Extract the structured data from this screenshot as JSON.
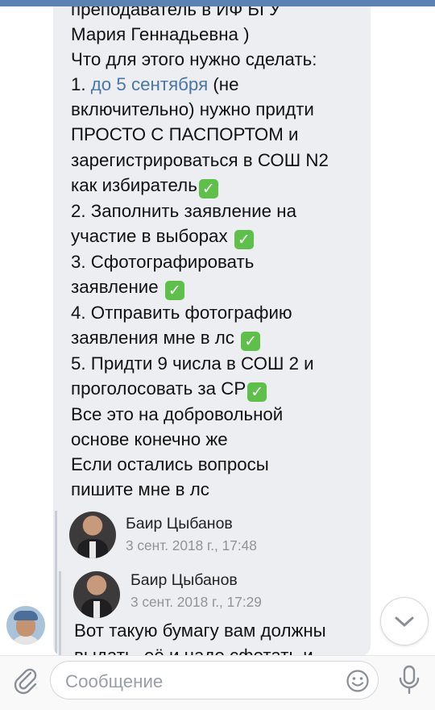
{
  "message": {
    "lines": [
      "преподаватель в ИФ БГУ",
      "Мария Геннадьевна )",
      "Что для этого нужно сделать:",
      "1. ",
      "до 5 сентября",
      " (не",
      "включительно) нужно придти",
      "ПРОСТО С ПАСПОРТОМ и",
      "зарегистрироваться в СОШ N2",
      "как избиратель",
      "2. Заполнить заявление на",
      "участие в выборах ",
      "3. Сфотографировать",
      "заявление ",
      "4. Отправить фотографию",
      "заявления мне в лс ",
      "5. Придти 9 числа в СОШ 2 и",
      "проголосовать за СР",
      "Все это на добровольной",
      "основе конечно же",
      "Если остались вопросы",
      "пишите мне в лс"
    ],
    "check_mark": "✓"
  },
  "forwarded": [
    {
      "name": "Баир Цыбанов",
      "date": "3 сент. 2018 г., 17:48"
    },
    {
      "name": "Баир Цыбанов",
      "date": "3 сент. 2018 г., 17:29"
    }
  ],
  "forwarded_text": {
    "line1": "Вот такую бумагу вам должны",
    "line2": "выдать, её и надо сфотать и"
  },
  "composer": {
    "placeholder": "Сообщение"
  },
  "icons": {
    "attach": "paperclip-icon",
    "emoji": "smiley-icon",
    "mic": "microphone-icon",
    "scroll": "chevron-down-icon"
  },
  "colors": {
    "link": "#4a76a8",
    "bubble": "#eceef1",
    "check": "#5ec04a",
    "topbar": "#5b82b3"
  }
}
